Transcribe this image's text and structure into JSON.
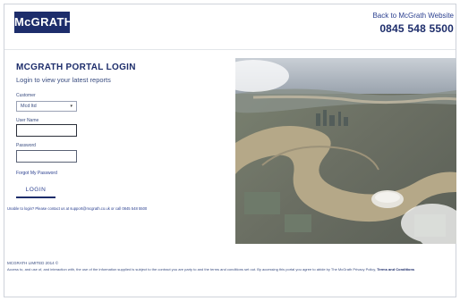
{
  "header": {
    "logo_text": "McGRATH",
    "back_link": "Back to McGrath Website",
    "phone": "0845 548 5500"
  },
  "login": {
    "title": "MCGRATH PORTAL LOGIN",
    "subtitle": "Login to view your latest reports",
    "customer_label": "Customer",
    "customer_value": "Mcd ltd",
    "user_label": "User Name",
    "password_label": "Password",
    "forgot_link": "Forgot My Password",
    "login_button": "LOGIN",
    "help_note": "Unable to login? Please contact us at support@mcgrath.co.uk or call 0845 548 5500"
  },
  "footer": {
    "address": "MCGRATH LIMITED 2014 ©",
    "legal_text": "Access to, and use of, and interaction with, the use of the information supplied is subject to the contract you are party to and the terms and conditions set out. By accessing this portal you agree to abide by The McGrath Privacy Policy,",
    "terms_link": "Terms and Conditions"
  },
  "colors": {
    "brand_navy": "#1d2d6b",
    "link_blue": "#2a3f8f"
  },
  "icons": {
    "select_chevron": "chevron-down-icon"
  }
}
